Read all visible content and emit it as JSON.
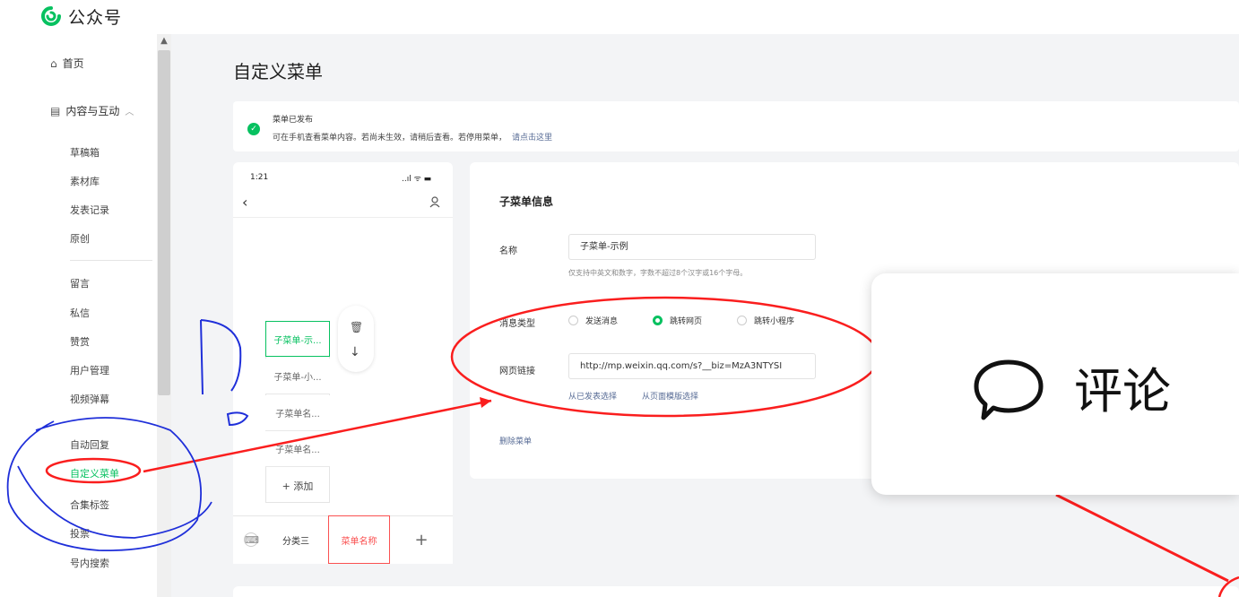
{
  "app": {
    "name": "公众号"
  },
  "sidebar": {
    "home": "首页",
    "group": "内容与互动",
    "items": [
      "草稿箱",
      "素材库",
      "发表记录",
      "原创",
      "留言",
      "私信",
      "赞赏",
      "用户管理",
      "视频弹幕",
      "自动回复",
      "自定义菜单",
      "合集标签",
      "投票",
      "号内搜索"
    ],
    "active": "自定义菜单"
  },
  "page": {
    "title": "自定义菜单"
  },
  "notice": {
    "title": "菜单已发布",
    "desc": "可在手机查看菜单内容。若尚未生效，请稍后查看。若停用菜单，",
    "link": "请点击这里"
  },
  "phone": {
    "time": "1:21",
    "status": "..ıl ᯤ ▬",
    "submenus": [
      "子菜单-示...",
      "子菜单-小...",
      "子菜单名...",
      "子菜单名..."
    ],
    "add_label": "+ 添加",
    "tabs": [
      "分类三",
      "菜单名称",
      "+"
    ]
  },
  "form": {
    "title": "子菜单信息",
    "name_label": "名称",
    "name_value": "子菜单-示例",
    "name_hint": "仅支持中英文和数字，字数不超过8个汉字或16个字母。",
    "type_label": "消息类型",
    "types": [
      "发送消息",
      "跳转网页",
      "跳转小程序"
    ],
    "selected_type": "跳转网页",
    "url_label": "网页链接",
    "url_value": "http://mp.weixin.qq.com/s?__biz=MzA3NTYSI",
    "url_links": [
      "从已发表选择",
      "从页面模版选择"
    ],
    "delete_label": "删除菜单"
  },
  "popup": {
    "label": "评论"
  },
  "colors": {
    "accent": "#07c160",
    "annotation_red": "#fa1e1e",
    "annotation_blue": "#1f2fd9",
    "link": "#576b95"
  }
}
